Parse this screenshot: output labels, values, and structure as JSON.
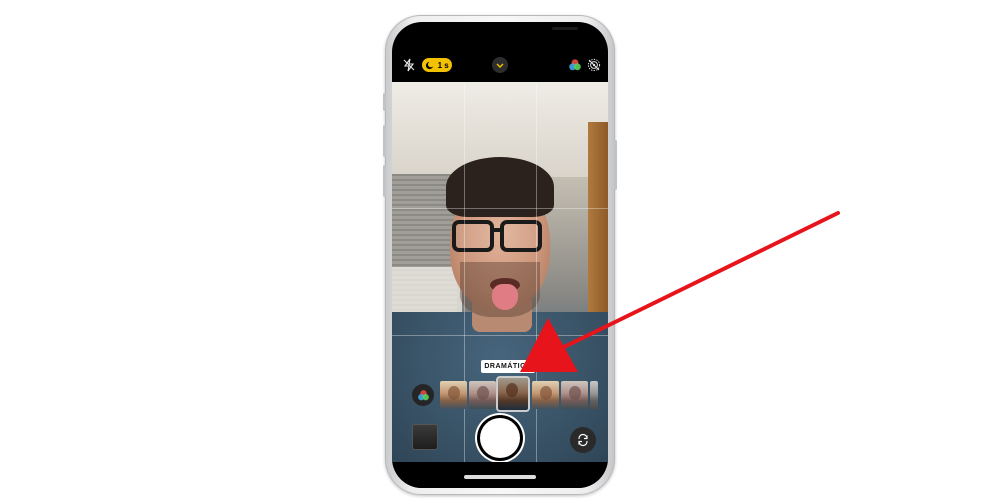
{
  "camera": {
    "top_bar": {
      "flash_icon": "flash-off-icon",
      "live_badge_text": "1 s",
      "chevron_icon": "chevron-down-icon",
      "filters_icon": "filters-icon",
      "live_photo_icon": "live-photo-off-icon"
    },
    "viewfinder": {
      "active_filter_label": "DRAMÁTICO"
    },
    "filters": {
      "items": [
        {
          "style": "warm"
        },
        {
          "style": "cool"
        },
        {
          "style": "dark",
          "selected": true
        },
        {
          "style": "warm"
        },
        {
          "style": "cool"
        },
        {
          "style": "mono"
        }
      ]
    },
    "bottom": {
      "shutter_icon": "shutter-button",
      "flip_icon": "camera-flip-icon",
      "gallery_icon": "gallery-thumbnail"
    }
  },
  "annotation": {
    "arrow_color": "#e8141b"
  },
  "colors": {
    "accent_yellow": "#f2c200",
    "screen_black": "#000000"
  }
}
